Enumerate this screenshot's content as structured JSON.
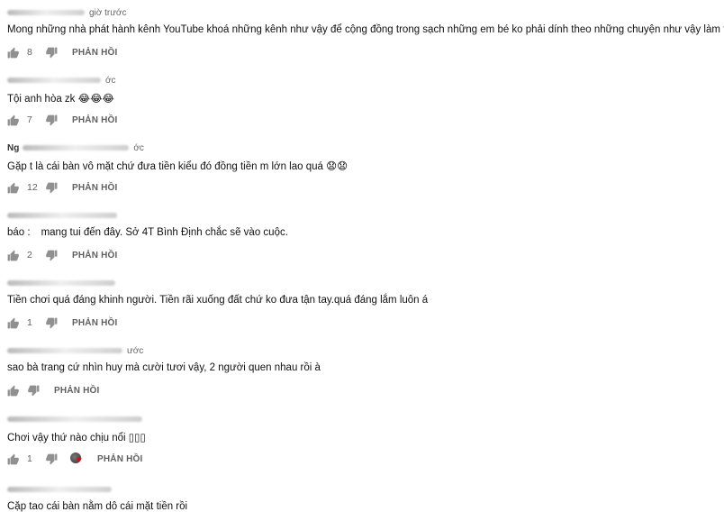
{
  "reply_label": "PHẢN HỒI",
  "comments": [
    {
      "meta": "giờ trước",
      "author": "",
      "text": "Mong những nhà phát hành kênh YouTube khoá những kênh như vậy để cộng đồng trong sạch những em bé ko phải dính theo những chuyện như vậy làm theo",
      "likes": "8"
    },
    {
      "meta": "ớc",
      "author": "",
      "text": "Tội anh hòa zk 😂😂😂",
      "likes": "7"
    },
    {
      "meta": "ớc",
      "author": "Ng",
      "text": "Gặp t là cái bàn vô mặt chứ đưa tiền kiểu đó đồng tiền m lớn lao quá 😧😧",
      "likes": "12"
    },
    {
      "meta": "",
      "author": "",
      "text_a": "báo :",
      "text_b": "mang tui đến đây. Sở 4T Bình Định chắc sẽ vào cuộc.",
      "likes": "2"
    },
    {
      "meta": "",
      "author": "",
      "text": "Tiền chơi quá đáng khinh người. Tiền rãi xuống đất chứ ko đưa tận tay.quá đáng lắm luôn á",
      "likes": "1"
    },
    {
      "meta": "ước",
      "author": "",
      "text": "sao bà trang cứ nhìn huy mà cười tươi vậy, 2 người quen nhau rồi à",
      "likes": ""
    },
    {
      "meta": "",
      "author": "",
      "text": "Chơi vậy thứ nào chịu nổi ▯▯▯",
      "likes": "1"
    },
    {
      "meta": "",
      "author": "",
      "text": "Cặp tao cái bàn nằm dô cái mặt tiền rồi"
    }
  ]
}
